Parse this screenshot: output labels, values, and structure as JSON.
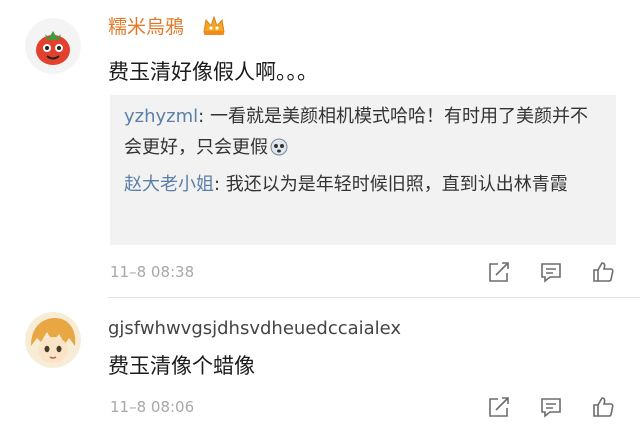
{
  "comments": [
    {
      "username": "糯米烏鴉",
      "badge_icon": "vip-crown-icon",
      "text": "费玉清好像假人啊。。。",
      "replies": [
        {
          "name": "yzhyzml",
          "separator": ": ",
          "text": "一看就是美颜相机模式哈哈！有时用了美颜并不会更好，只会更假",
          "emoji": "face-emoji-icon"
        },
        {
          "name": "赵大老小姐",
          "separator": ": ",
          "text": "我还以为是年轻时候旧照，直到认出林青霞"
        }
      ],
      "timestamp": "11–8 08:38",
      "actions": [
        "share-icon",
        "comment-icon",
        "like-icon"
      ]
    },
    {
      "username": "gjsfwhwvgsjdhsvdheuedccaialex",
      "text": "费玉清像个蜡像",
      "timestamp": "11–8 08:06",
      "actions": [
        "share-icon",
        "comment-icon",
        "like-icon"
      ]
    }
  ],
  "colors": {
    "vip_name": "#e2792a",
    "reply_name": "#5b7fa8",
    "timestamp": "#a8a8a8",
    "reply_bg": "#f2f2f2"
  }
}
